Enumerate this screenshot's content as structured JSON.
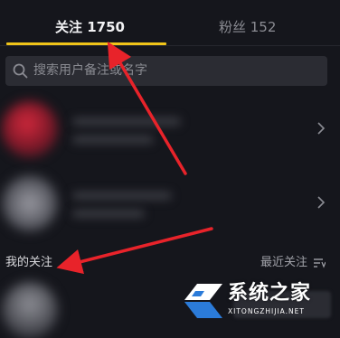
{
  "tabs": {
    "following_label": "关注 1750",
    "fans_label": "粉丝 152"
  },
  "search": {
    "placeholder": "搜索用户备注或名字"
  },
  "section": {
    "title": "我的关注",
    "sort_label": "最近关注"
  },
  "watermark": {
    "brand": "系统之家",
    "site": "XITONGZHIJIA.NET"
  },
  "colors": {
    "background": "#15161c",
    "accent": "#f0c419",
    "annotation_arrow": "#e8232a"
  },
  "icons": {
    "search": "search-icon",
    "chevron": "chevron-right-icon",
    "sort": "sort-icon"
  }
}
